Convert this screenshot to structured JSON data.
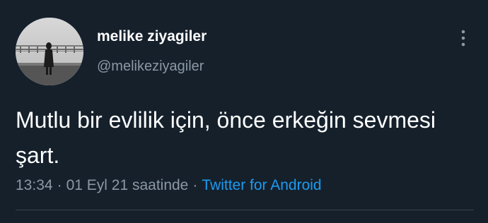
{
  "user": {
    "display_name": "melike ziyagiler",
    "handle": "@melikeziyagiler"
  },
  "tweet": {
    "text": "Mutlu bir evlilik için, önce erkeğin sevmesi şart."
  },
  "meta": {
    "time": "13:34",
    "date": "01 Eyl 21 saatinde",
    "separator": "·",
    "source": "Twitter for Android"
  },
  "icons": {
    "menu": "more-vertical-icon",
    "avatar": "profile-photo"
  },
  "colors": {
    "background": "#15202b",
    "text_primary": "#ffffff",
    "text_secondary": "#8b98a5",
    "link": "#1d9bf0",
    "divider": "#38444d"
  }
}
